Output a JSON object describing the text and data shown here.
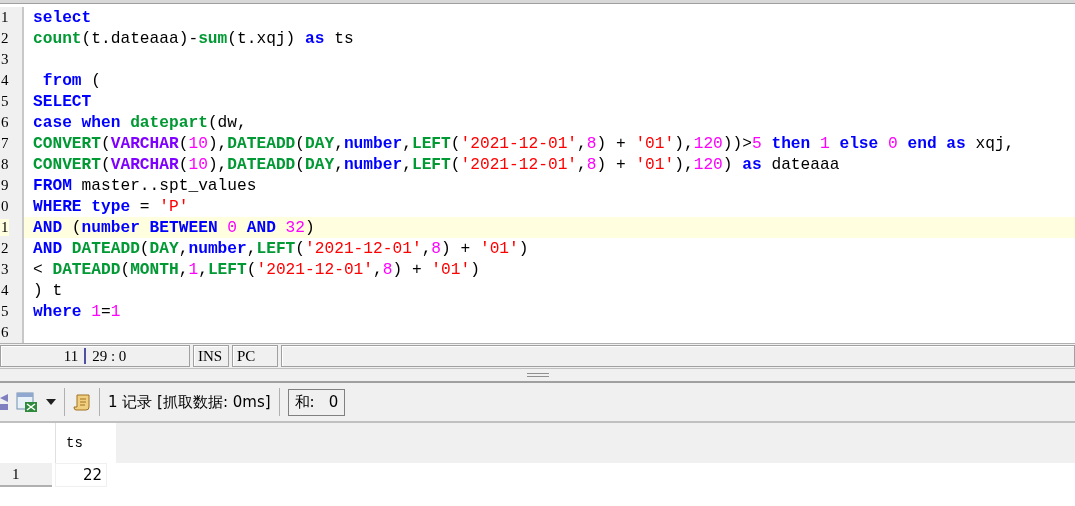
{
  "editor": {
    "lines": [
      {
        "number": "1",
        "current": false,
        "segments": [
          {
            "kind": "kw",
            "text": "select"
          }
        ]
      },
      {
        "number": "2",
        "current": false,
        "segments": [
          {
            "kind": "fn",
            "text": "count"
          },
          {
            "kind": "plain",
            "text": "(t.dateaaa)-"
          },
          {
            "kind": "fn",
            "text": "sum"
          },
          {
            "kind": "plain",
            "text": "(t.xqj) "
          },
          {
            "kind": "kw",
            "text": "as"
          },
          {
            "kind": "plain",
            "text": " ts"
          }
        ]
      },
      {
        "number": "3",
        "current": false
      },
      {
        "number": "4",
        "current": false,
        "segments": [
          {
            "kind": "kw",
            "text": " from"
          },
          {
            "kind": "plain",
            "text": " ("
          }
        ]
      },
      {
        "number": "5",
        "current": false,
        "segments": [
          {
            "kind": "kw",
            "text": "SELECT"
          }
        ]
      },
      {
        "number": "6",
        "current": false,
        "segments": [
          {
            "kind": "kw",
            "text": "case when "
          },
          {
            "kind": "fn",
            "text": "datepart"
          },
          {
            "kind": "plain",
            "text": "(dw,"
          }
        ]
      },
      {
        "number": "7",
        "current": false,
        "segments": [
          {
            "kind": "fn",
            "text": "CONVERT"
          },
          {
            "kind": "plain",
            "text": "("
          },
          {
            "kind": "type",
            "text": "VARCHAR"
          },
          {
            "kind": "plain",
            "text": "("
          },
          {
            "kind": "num",
            "text": "10"
          },
          {
            "kind": "plain",
            "text": "),"
          },
          {
            "kind": "fn",
            "text": "DATEADD"
          },
          {
            "kind": "plain",
            "text": "("
          },
          {
            "kind": "fn",
            "text": "DAY"
          },
          {
            "kind": "plain",
            "text": ","
          },
          {
            "kind": "kw",
            "text": "number"
          },
          {
            "kind": "plain",
            "text": ","
          },
          {
            "kind": "fn",
            "text": "LEFT"
          },
          {
            "kind": "plain",
            "text": "("
          },
          {
            "kind": "str",
            "text": "'2021-12-01'"
          },
          {
            "kind": "plain",
            "text": ","
          },
          {
            "kind": "num",
            "text": "8"
          },
          {
            "kind": "plain",
            "text": ") + "
          },
          {
            "kind": "str",
            "text": "'01'"
          },
          {
            "kind": "plain",
            "text": "),"
          },
          {
            "kind": "num",
            "text": "120"
          },
          {
            "kind": "plain",
            "text": "))>"
          },
          {
            "kind": "num",
            "text": "5"
          },
          {
            "kind": "kw",
            "text": " then "
          },
          {
            "kind": "num",
            "text": "1"
          },
          {
            "kind": "kw",
            "text": " else "
          },
          {
            "kind": "num",
            "text": "0"
          },
          {
            "kind": "kw",
            "text": " end as"
          },
          {
            "kind": "plain",
            "text": " xqj,"
          }
        ]
      },
      {
        "number": "8",
        "current": false,
        "segments": [
          {
            "kind": "fn",
            "text": "CONVERT"
          },
          {
            "kind": "plain",
            "text": "("
          },
          {
            "kind": "type",
            "text": "VARCHAR"
          },
          {
            "kind": "plain",
            "text": "("
          },
          {
            "kind": "num",
            "text": "10"
          },
          {
            "kind": "plain",
            "text": "),"
          },
          {
            "kind": "fn",
            "text": "DATEADD"
          },
          {
            "kind": "plain",
            "text": "("
          },
          {
            "kind": "fn",
            "text": "DAY"
          },
          {
            "kind": "plain",
            "text": ","
          },
          {
            "kind": "kw",
            "text": "number"
          },
          {
            "kind": "plain",
            "text": ","
          },
          {
            "kind": "fn",
            "text": "LEFT"
          },
          {
            "kind": "plain",
            "text": "("
          },
          {
            "kind": "str",
            "text": "'2021-12-01'"
          },
          {
            "kind": "plain",
            "text": ","
          },
          {
            "kind": "num",
            "text": "8"
          },
          {
            "kind": "plain",
            "text": ") + "
          },
          {
            "kind": "str",
            "text": "'01'"
          },
          {
            "kind": "plain",
            "text": "),"
          },
          {
            "kind": "num",
            "text": "120"
          },
          {
            "kind": "plain",
            "text": ") "
          },
          {
            "kind": "kw",
            "text": "as"
          },
          {
            "kind": "plain",
            "text": " dateaaa"
          }
        ]
      },
      {
        "number": "9",
        "current": false,
        "segments": [
          {
            "kind": "kw",
            "text": "FROM"
          },
          {
            "kind": "plain",
            "text": " master..spt_values"
          }
        ]
      },
      {
        "number": "0",
        "current": false,
        "segments": [
          {
            "kind": "kw",
            "text": "WHERE type"
          },
          {
            "kind": "plain",
            "text": " = "
          },
          {
            "kind": "str",
            "text": "'P'"
          }
        ]
      },
      {
        "number": "1",
        "current": true,
        "segments": [
          {
            "kind": "kw",
            "text": "AND"
          },
          {
            "kind": "plain",
            "text": " ("
          },
          {
            "kind": "kw",
            "text": "number BETWEEN "
          },
          {
            "kind": "num",
            "text": "0"
          },
          {
            "kind": "kw",
            "text": " AND "
          },
          {
            "kind": "num",
            "text": "32"
          },
          {
            "kind": "plain",
            "text": ")"
          }
        ]
      },
      {
        "number": "2",
        "current": false,
        "segments": [
          {
            "kind": "kw",
            "text": "AND "
          },
          {
            "kind": "fn",
            "text": "DATEADD"
          },
          {
            "kind": "plain",
            "text": "("
          },
          {
            "kind": "fn",
            "text": "DAY"
          },
          {
            "kind": "plain",
            "text": ","
          },
          {
            "kind": "kw",
            "text": "number"
          },
          {
            "kind": "plain",
            "text": ","
          },
          {
            "kind": "fn",
            "text": "LEFT"
          },
          {
            "kind": "plain",
            "text": "("
          },
          {
            "kind": "str",
            "text": "'2021-12-01'"
          },
          {
            "kind": "plain",
            "text": ","
          },
          {
            "kind": "num",
            "text": "8"
          },
          {
            "kind": "plain",
            "text": ") + "
          },
          {
            "kind": "str",
            "text": "'01'"
          },
          {
            "kind": "plain",
            "text": ")"
          }
        ]
      },
      {
        "number": "3",
        "current": false,
        "segments": [
          {
            "kind": "plain",
            "text": "< "
          },
          {
            "kind": "fn",
            "text": "DATEADD"
          },
          {
            "kind": "plain",
            "text": "("
          },
          {
            "kind": "fn",
            "text": "MONTH"
          },
          {
            "kind": "plain",
            "text": ","
          },
          {
            "kind": "num",
            "text": "1"
          },
          {
            "kind": "plain",
            "text": ","
          },
          {
            "kind": "fn",
            "text": "LEFT"
          },
          {
            "kind": "plain",
            "text": "("
          },
          {
            "kind": "str",
            "text": "'2021-12-01'"
          },
          {
            "kind": "plain",
            "text": ","
          },
          {
            "kind": "num",
            "text": "8"
          },
          {
            "kind": "plain",
            "text": ") + "
          },
          {
            "kind": "str",
            "text": "'01'"
          },
          {
            "kind": "plain",
            "text": ")"
          }
        ]
      },
      {
        "number": "4",
        "current": false,
        "segments": [
          {
            "kind": "plain",
            "text": ") t"
          }
        ]
      },
      {
        "number": "5",
        "current": false,
        "segments": [
          {
            "kind": "kw",
            "text": "where "
          },
          {
            "kind": "num",
            "text": "1"
          },
          {
            "kind": "plain",
            "text": "="
          },
          {
            "kind": "num",
            "text": "1"
          }
        ]
      },
      {
        "number": "6",
        "current": false
      }
    ]
  },
  "status_bar": {
    "line": "11",
    "position": "29 : 0",
    "mode": "INS",
    "line_ending": "PC"
  },
  "result_toolbar": {
    "summary": "1 记录 [抓取数据: 0ms]",
    "sum_label": "和:",
    "sum_value": "0"
  },
  "result_grid": {
    "columns": [
      "ts"
    ],
    "rows": [
      {
        "row_number": "1",
        "cells": [
          "22"
        ]
      }
    ]
  }
}
